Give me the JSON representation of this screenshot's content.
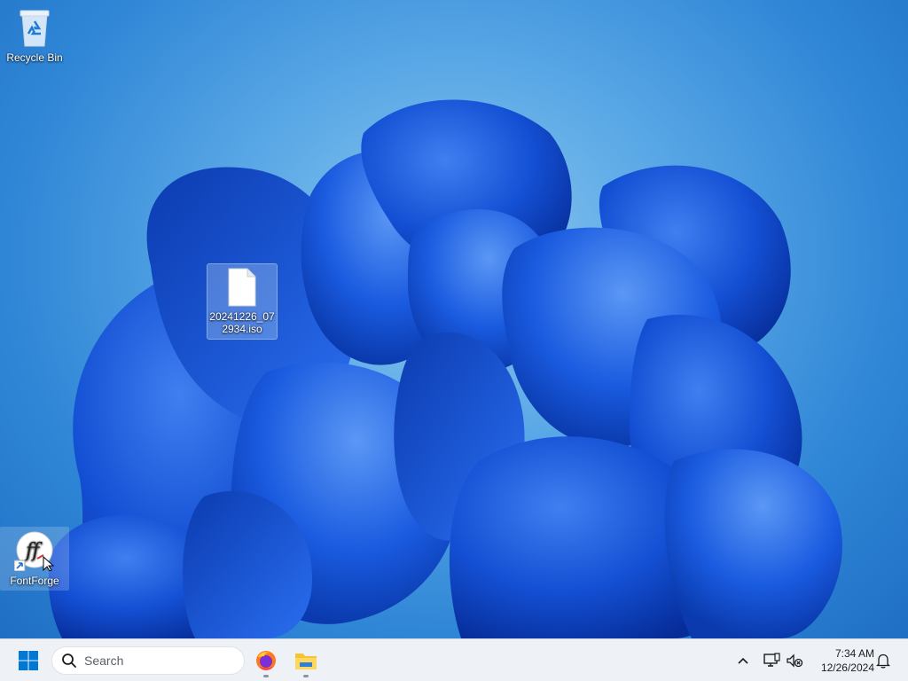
{
  "desktop": {
    "icons": [
      {
        "label": "Recycle Bin",
        "icon": "recycle-bin-icon"
      },
      {
        "label": "20241226_072934.iso",
        "icon": "file-icon",
        "selected": true
      },
      {
        "label": "FontForge",
        "icon": "fontforge-icon",
        "shortcut": true
      }
    ]
  },
  "taskbar": {
    "start_icon": "windows-logo-icon",
    "search": {
      "placeholder": "Search",
      "icon": "search-icon"
    },
    "apps": [
      {
        "name": "Firefox",
        "icon": "firefox-icon",
        "running": true
      },
      {
        "name": "File Explorer",
        "icon": "folder-icon",
        "running": true
      }
    ],
    "tray": {
      "icons": [
        "chevron-up-icon",
        "network-icon",
        "sound-muted-icon",
        "bell-icon"
      ],
      "time": "7:34 AM",
      "date": "12/26/2024"
    }
  },
  "colors": {
    "wallpaper_bg": "#3f96dc",
    "petals": "#0d47c9",
    "taskbar_bg": "#eef2f7",
    "windows_blue": "#0078d4"
  }
}
